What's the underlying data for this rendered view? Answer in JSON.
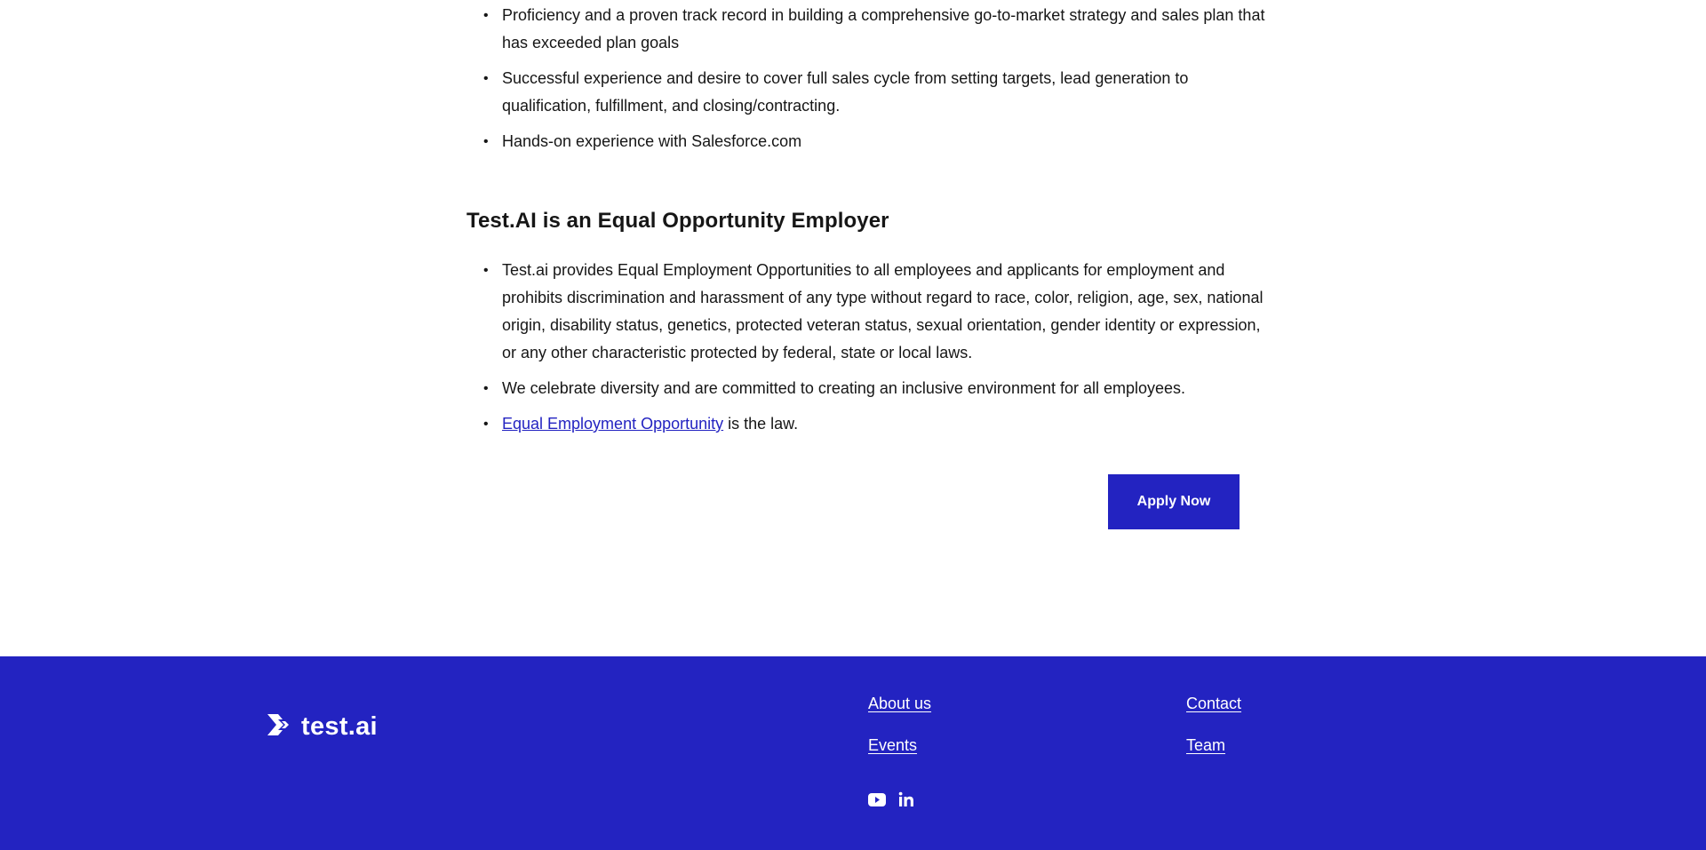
{
  "list_a": [
    "Proficiency and a proven track record in building a comprehensive go-to-market strategy and sales plan that has exceeded plan goals",
    "Successful experience and desire to cover full sales cycle from setting targets, lead generation to qualification, fulfillment, and closing/contracting.",
    "Hands-on experience with Salesforce.com"
  ],
  "heading": "Test.AI is an Equal Opportunity Employer",
  "list_b": [
    "Test.ai provides Equal Employment Opportunities to all employees and applicants for employment and prohibits discrimination and harassment of any type without regard to race, color, religion, age, sex, national origin, disability status, genetics, protected veteran status, sexual orientation, gender identity or expression, or any other characteristic protected by federal, state or local laws.",
    "We celebrate diversity and are committed to creating an inclusive environment for all employees."
  ],
  "eeo_link": "Equal Employment Opportunity",
  "eeo_suffix": " is the law.",
  "apply_label": "Apply Now",
  "footer": {
    "logo_text": "test.ai",
    "links": {
      "about": "About us",
      "events": "Events",
      "contact": "Contact",
      "team": "Team"
    },
    "social": [
      "youtube-icon",
      "linkedin-icon"
    ]
  },
  "colors": {
    "brand": "#2323c1",
    "text": "#161616"
  }
}
